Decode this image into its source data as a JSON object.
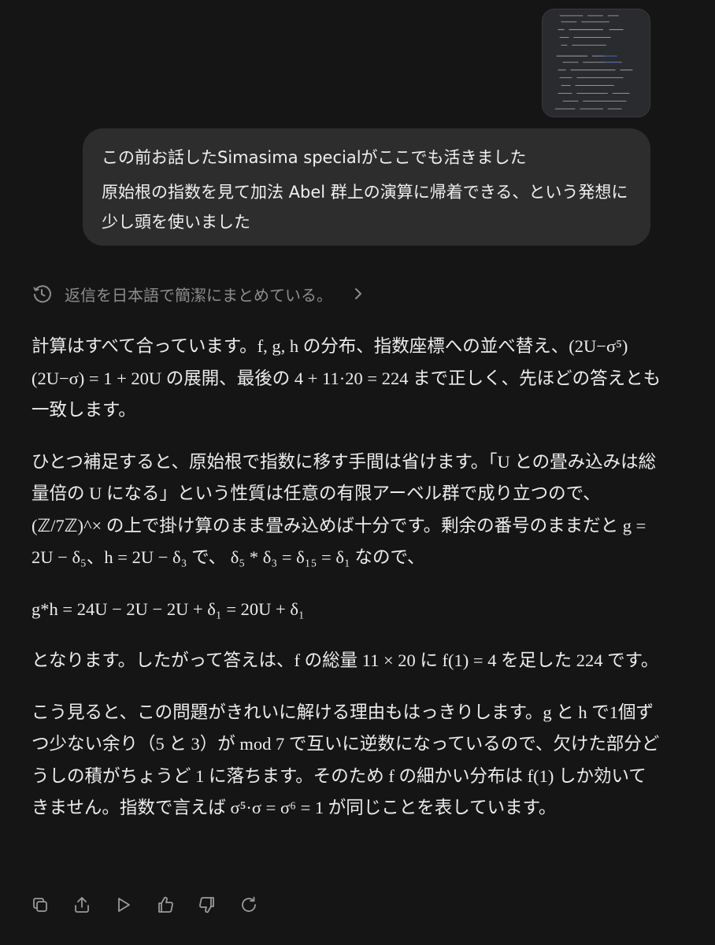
{
  "user_message": {
    "line1": "この前お話したSimasima specialがここでも活きました",
    "line2": "原始根の指数を見て加法 Abel 群上の演算に帰着できる、という発想に少し頭を使いました"
  },
  "thinking": {
    "label": "返信を日本語で簡潔にまとめている。"
  },
  "answer": {
    "p1": "計算はすべて合っています。f, g, h の分布、指数座標への並べ替え、(2U−σ⁵)(2U−σ) = 1 + 20U の展開、最後の 4 + 11·20 = 224 まで正しく、先ほどの答えとも一致します。",
    "p2": "ひとつ補足すると、原始根で指数に移す手間は省けます。「U との畳み込みは総量倍の U になる」という性質は任意の有限アーベル群で成り立つので、(ℤ/7ℤ)^× の上で掛け算のまま畳み込めば十分です。剰余の番号のままだと g = 2U − δ₅、h = 2U − δ₃ で、 δ₅ * δ₃ = δ₁₅ = δ₁ なので、",
    "p3": "g*h = 24U − 2U − 2U + δ₁ = 20U + δ₁",
    "p4": "となります。したがって答えは、f の総量 11 × 20 に f(1) = 4 を足した 224 です。",
    "p5": "こう見ると、この問題がきれいに解ける理由もはっきりします。g と h で1個ずつ少ない余り（5 と 3）が mod 7 で互いに逆数になっているので、欠けた部分どうしの積がちょうど 1 に落ちます。そのため f の細かい分布は f(1) しか効いてきません。指数で言えば σ⁵·σ = σ⁶ = 1 が同じことを表しています。"
  },
  "actions": [
    "copy-icon",
    "share-icon",
    "play-icon",
    "thumbs-up-icon",
    "thumbs-down-icon",
    "regenerate-icon"
  ],
  "colors": {
    "background": "#151515",
    "bubble": "#2d2d2d",
    "text": "#ececec",
    "muted": "#8d8d8d"
  }
}
